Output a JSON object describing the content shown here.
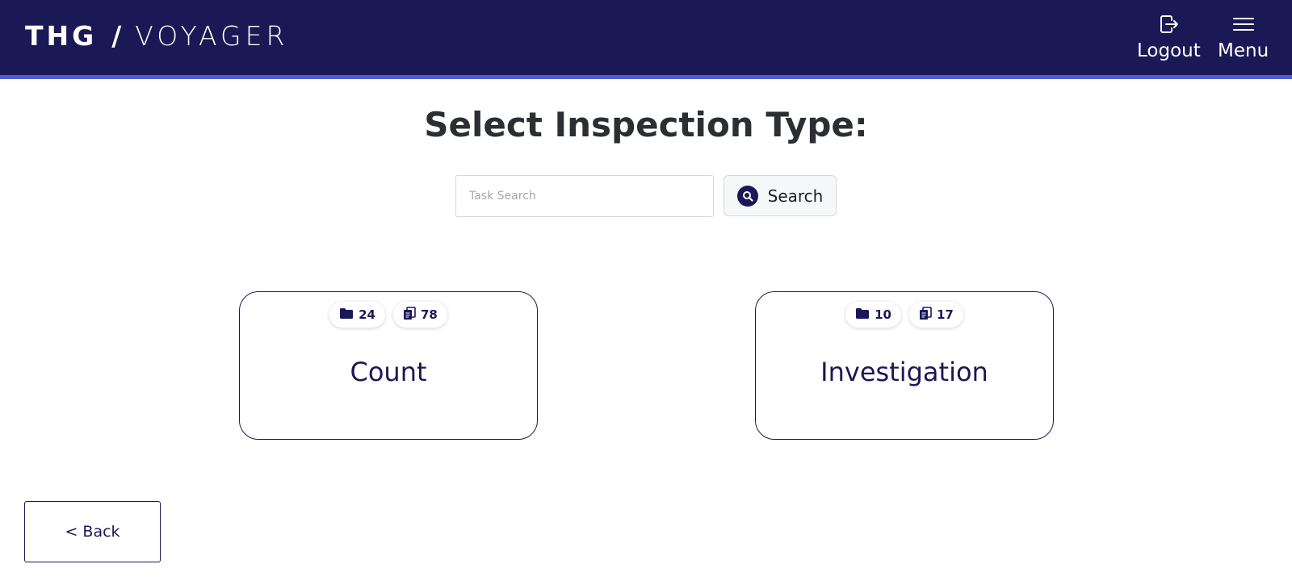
{
  "header": {
    "logo": {
      "brand": "THG",
      "separator": "/",
      "product": "VOYAGER"
    },
    "logout_label": "Logout",
    "menu_label": "Menu",
    "background_color": "#1b1856",
    "accent_color": "#4d5ed8"
  },
  "page_title": "Select Inspection Type:",
  "search": {
    "placeholder": "Task Search",
    "value": "",
    "button_label": "Search"
  },
  "cards": [
    {
      "label": "Count",
      "folder_count": "24",
      "task_count": "78"
    },
    {
      "label": "Investigation",
      "folder_count": "10",
      "task_count": "17"
    }
  ],
  "back_label": "< Back",
  "icons": [
    "logout-icon",
    "hamburger-menu-icon",
    "search-icon",
    "folder-icon",
    "clipboard-icon"
  ]
}
